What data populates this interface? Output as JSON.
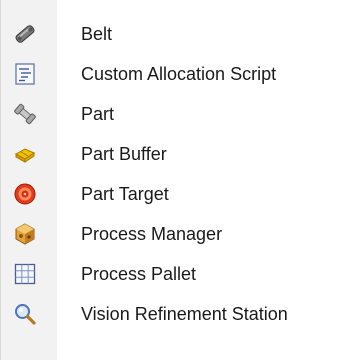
{
  "menu": {
    "items": [
      {
        "label": "Belt",
        "icon": "belt-icon"
      },
      {
        "label": "Custom Allocation Script",
        "icon": "script-icon"
      },
      {
        "label": "Part",
        "icon": "part-icon"
      },
      {
        "label": "Part Buffer",
        "icon": "part-buffer-icon"
      },
      {
        "label": "Part Target",
        "icon": "part-target-icon"
      },
      {
        "label": "Process Manager",
        "icon": "process-manager-icon"
      },
      {
        "label": "Process Pallet",
        "icon": "process-pallet-icon"
      },
      {
        "label": "Vision Refinement Station",
        "icon": "vision-refinement-icon"
      }
    ]
  }
}
